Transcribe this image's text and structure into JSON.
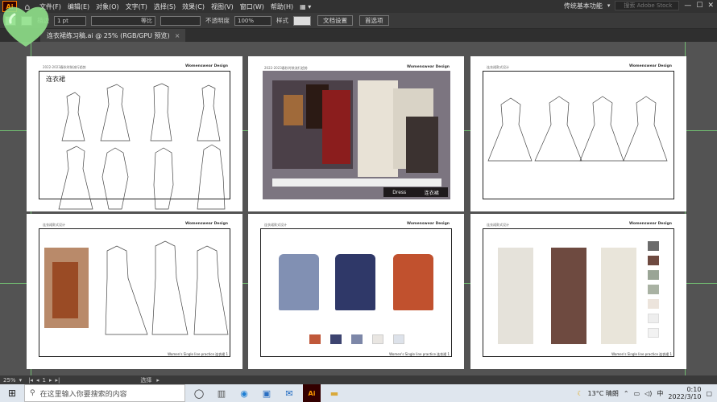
{
  "app": {
    "logo": "Ai",
    "menus": [
      "文件(F)",
      "编辑(E)",
      "对象(O)",
      "文字(T)",
      "选择(S)",
      "效果(C)",
      "视图(V)",
      "窗口(W)",
      "帮助(H)"
    ],
    "workspace": "传统基本功能",
    "search_placeholder": "搜索 Adobe Stock"
  },
  "control_bar": {
    "stroke_label": "描边",
    "stroke_value": "1 pt",
    "stroke_style": "等比",
    "opacity_label": "不透明度",
    "opacity_value": "100%",
    "style_label": "样式",
    "doc_setup_button": "文档设置",
    "preferences_button": "首选项"
  },
  "document_tab": {
    "title": "连衣裙练习稿.ai @ 25% (RGB/GPU 预览)",
    "close": "×"
  },
  "artboards": [
    {
      "caption_left": "2022-2023春秋时装流行趋势",
      "caption_right": "Womenswear Design",
      "heading": "连衣裙"
    },
    {
      "caption_left": "2022-2023春秋时装流行趋势",
      "caption_right": "Womenswear Design",
      "label_dress": "Dress",
      "label_cn": "连衣裙"
    },
    {
      "caption_left": "连衣裙款式设计",
      "caption_right": "Womenswear Design"
    },
    {
      "caption_left": "连衣裙款式设计",
      "caption_right": "Womenswear Design",
      "footer": "Women's Single line practice 连衣裙 1"
    },
    {
      "caption_left": "连衣裙款式设计",
      "caption_right": "Womenswear Design",
      "footer": "Women's Single line practice 连衣裙 1"
    },
    {
      "caption_left": "连衣裙款式设计",
      "caption_right": "Womenswear Design",
      "footer": "Women's Single line practice 连衣裙 1"
    }
  ],
  "palette_artboard5": [
    "#c0583a",
    "#3d4470",
    "#7d87a8",
    "#e9e6e2",
    "#dde2ea"
  ],
  "palette_artboard6": [
    "#6b6b6b",
    "#6e4a40",
    "#9aa596",
    "#a9b2a3",
    "#ece4dc",
    "#eeeeee",
    "#f2f2f2"
  ],
  "status_bar": {
    "zoom": "25%",
    "page": "1",
    "tool": "选择"
  },
  "taskbar": {
    "search_placeholder": "在这里输入你要搜索的内容",
    "weather": "13°C 晴朗",
    "ime": "中",
    "time": "0:10",
    "date": "2022/3/10"
  }
}
